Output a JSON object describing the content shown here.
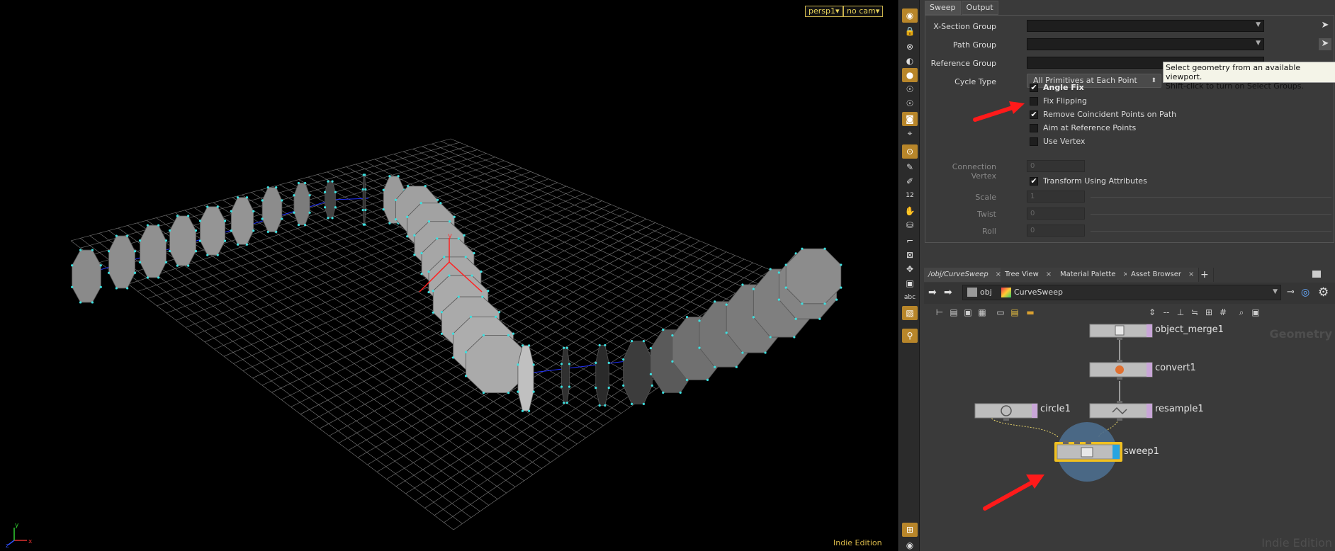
{
  "viewport": {
    "camera_label": "persp1▾",
    "cam_label": "no cam▾",
    "edition": "Indie Edition",
    "axis_labels": {
      "x": "x",
      "y": "y",
      "z": "z"
    },
    "handle_label": "y"
  },
  "toolbar": {
    "items": [
      "view-icon",
      "lock-icon",
      "snap-icon",
      "display-icon",
      "light-icon",
      "bulb-icon",
      "bulb2-icon",
      "camera-icon",
      "select-icon",
      "point-icon",
      "brush-icon",
      "pen-icon",
      "number-icon",
      "hand-icon",
      "bucket-icon",
      "ruler-icon",
      "transform-icon",
      "move-icon",
      "box-icon",
      "abc-icon",
      "image-icon",
      "pin-icon"
    ],
    "abc": "abc",
    "num": "12"
  },
  "params": {
    "tabs": [
      "Sweep",
      "Output"
    ],
    "active_tab": "Sweep",
    "fields": {
      "xsection_group": "X-Section Group",
      "path_group": "Path Group",
      "reference_group": "Reference Group",
      "cycle_type": "Cycle Type",
      "cycle_value": "All Primitives at Each Point"
    },
    "checkboxes": [
      {
        "label": "Angle Fix",
        "checked": true,
        "bold": true
      },
      {
        "label": "Fix Flipping",
        "checked": false
      },
      {
        "label": "Remove Coincident Points on Path",
        "checked": true
      },
      {
        "label": "Aim at Reference Points",
        "checked": false
      },
      {
        "label": "Use Vertex",
        "checked": false
      }
    ],
    "connection_vertex": {
      "label": "Connection Vertex",
      "value": "0"
    },
    "transform_attrs": {
      "label": "Transform Using Attributes",
      "checked": true
    },
    "scale": {
      "label": "Scale",
      "value": "1"
    },
    "twist": {
      "label": "Twist",
      "value": "0"
    },
    "roll": {
      "label": "Roll",
      "value": "0"
    },
    "tooltip": {
      "line1": "Select geometry from an available viewport.",
      "line2": "Shift-click to turn on Select Groups."
    }
  },
  "network": {
    "tabs": [
      {
        "label": "/obj/CurveSweep",
        "active": true
      },
      {
        "label": "Tree View"
      },
      {
        "label": "Material Palette"
      },
      {
        "label": "Asset Browser"
      }
    ],
    "add_tab": "+",
    "close": "×",
    "path": {
      "root": "obj",
      "node": "CurveSweep"
    },
    "context_label": "Geometry",
    "edition": "Indie Edition",
    "nodes": {
      "object_merge": "object_merge1",
      "convert": "convert1",
      "circle": "circle1",
      "resample": "resample1",
      "sweep": "sweep1"
    }
  },
  "colors": {
    "accent": "#b8862a",
    "node_flag": "#28a4e0",
    "selected_node": "#f0c020",
    "arrow": "#ff1a1a",
    "point": "#3de0e0"
  }
}
